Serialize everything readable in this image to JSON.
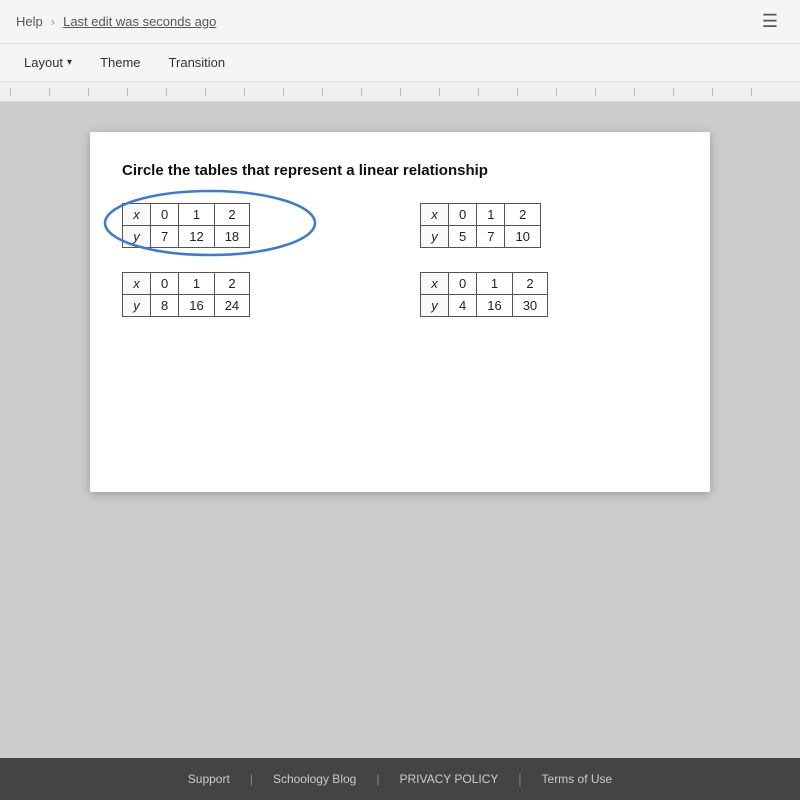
{
  "header": {
    "help_label": "Help",
    "separator": "›",
    "last_edit": "Last edit was seconds ago",
    "comment_icon": "☰"
  },
  "toolbar": {
    "layout_label": "Layout",
    "theme_label": "Theme",
    "transition_label": "Transition"
  },
  "slide": {
    "title": "Circle the tables that represent a linear relationship",
    "tables": [
      {
        "id": "table1",
        "x_values": [
          "x",
          "0",
          "1",
          "2"
        ],
        "y_values": [
          "y",
          "7",
          "12",
          "18"
        ],
        "circled": true
      },
      {
        "id": "table2",
        "x_values": [
          "x",
          "0",
          "1",
          "2"
        ],
        "y_values": [
          "y",
          "5",
          "7",
          "10"
        ],
        "circled": false
      },
      {
        "id": "table3",
        "x_values": [
          "x",
          "0",
          "1",
          "2"
        ],
        "y_values": [
          "y",
          "8",
          "16",
          "24"
        ],
        "circled": false
      },
      {
        "id": "table4",
        "x_values": [
          "x",
          "0",
          "1",
          "2"
        ],
        "y_values": [
          "y",
          "4",
          "16",
          "30"
        ],
        "circled": false
      }
    ]
  },
  "footer": {
    "support": "Support",
    "blog": "Schoology Blog",
    "privacy": "PRIVACY POLICY",
    "terms": "Terms of Use"
  }
}
